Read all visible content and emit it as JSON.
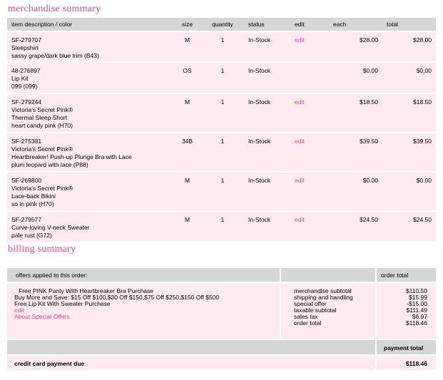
{
  "merchandise_summary": {
    "title": "merchandise summary",
    "headers": {
      "description": "item description / color",
      "size": "size",
      "quantity": "quantity",
      "status": "status",
      "edit": "edit",
      "each": "each",
      "total": "total"
    },
    "items": [
      {
        "sku": "SF-279707",
        "brand": "",
        "name": "Sleepshirt",
        "color": "sassy grape/dark blue trim (B43)",
        "size": "M",
        "quantity": "1",
        "status": "In-Stock",
        "edit": "edit",
        "each": "$28.00",
        "total": "$28.00"
      },
      {
        "sku": "48-276897",
        "brand": "",
        "name": "Lip Kit",
        "color": "099 (099)",
        "size": "OS",
        "quantity": "1",
        "status": "In-Stock",
        "edit": "",
        "each": "$0.00",
        "total": "$0.00"
      },
      {
        "sku": "SF-279244",
        "brand": "Victoria's Secret Pink®",
        "name": "Thermal Sleep Short",
        "color": "heart candy pink (H70)",
        "size": "M",
        "quantity": "1",
        "status": "In-Stock",
        "edit": "edit",
        "each": "$18.50",
        "total": "$18.50"
      },
      {
        "sku": "SF-275381",
        "brand": "Victoria's Secret Pink®",
        "name": "Heartbreaker! Push-up Plunge Bra with Lace",
        "color": "plum leopard with lace (P88)",
        "size": "34B",
        "quantity": "1",
        "status": "In-Stock",
        "edit": "edit",
        "each": "$39.50",
        "total": "$39.50"
      },
      {
        "sku": "SF-269800",
        "brand": "Victoria's Secret Pink®",
        "name": "Lace-back Bikini",
        "color": "so in pink (H70)",
        "size": "M",
        "quantity": "1",
        "status": "In-Stock",
        "edit": "edit",
        "each": "$0.00",
        "total": "$0.00"
      },
      {
        "sku": "SF-279577",
        "brand": "",
        "name": "Curve-loving V-neck Sweater",
        "color": "pale rust (G72)",
        "size": "M",
        "quantity": "1",
        "status": "In-Stock",
        "edit": "edit",
        "each": "$24.50",
        "total": "$24.50"
      }
    ]
  },
  "billing_summary": {
    "title": "billing summary",
    "offers_header": "offers applied to this order:",
    "order_total_header": "order total",
    "offers": [
      "Free PINK Panty With Heartbreaker Bra Purchase",
      "Buy More and Save: $15 Off $100,$30 Off $150,$75 Off $250,$150 Off $500",
      "Free Lip Kit With Sweater Purchase"
    ],
    "edit_link": "edit",
    "about_link": "About Special Offers",
    "summary_labels": [
      "merchandise subtotal",
      "shipping and handling",
      "special offer",
      "taxable subtotal",
      "sales tax",
      "order total"
    ],
    "summary_values": [
      "$110.50",
      "$15.99",
      "-$15.00",
      "$111.49",
      "$6.97",
      "$118.46"
    ],
    "payment_total_header": "payment total",
    "payment_due_label": "credit card payment due",
    "payment_due_value": "$118.46"
  },
  "colors": {
    "accent": "#e64b8c",
    "header_bg": "#d6d6d6",
    "row_bg": "#fdebf1"
  }
}
